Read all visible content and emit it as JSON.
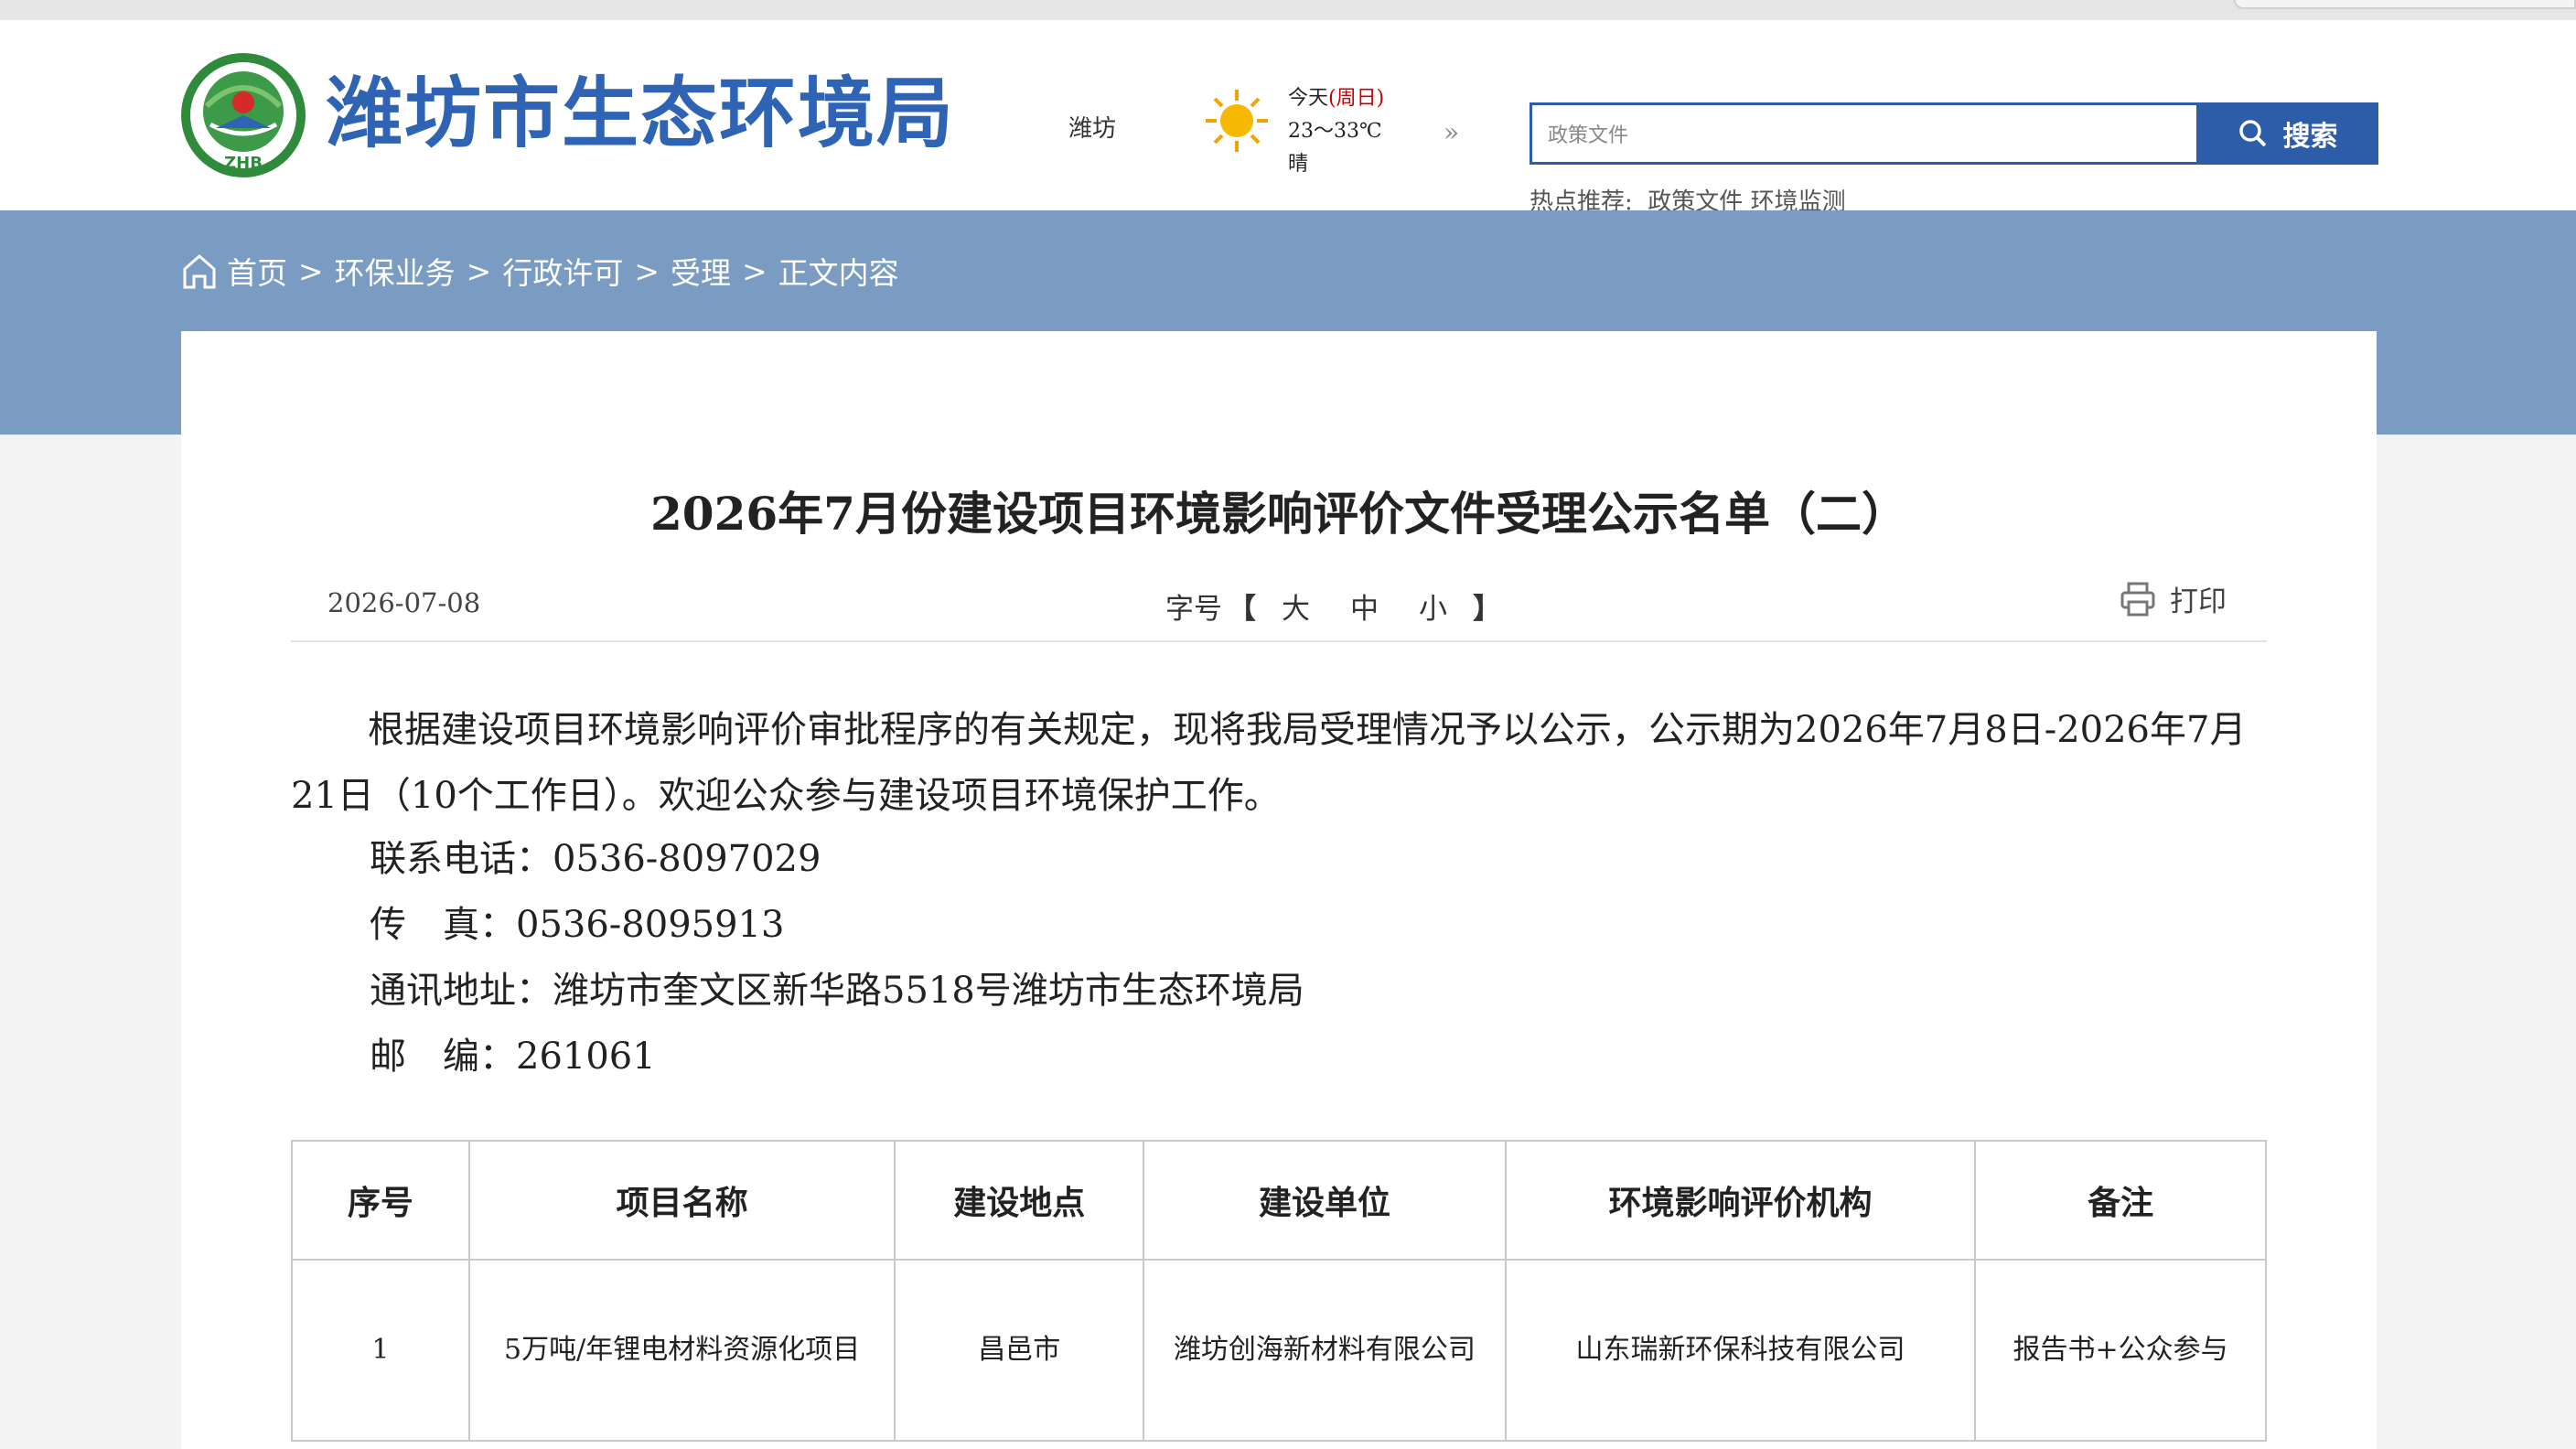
{
  "site": {
    "title": "潍坊市生态环境局",
    "logo_text": "ZHB"
  },
  "weather": {
    "city": "潍坊",
    "day": "今天",
    "weekday": "周日",
    "temp": "23～33℃",
    "condition": "晴",
    "icon": "sun-icon",
    "more_icon": "double-chevron-right-icon"
  },
  "search": {
    "placeholder": "政策文件",
    "button_label": "搜索",
    "hot_label": "热点推荐:",
    "hot_items": [
      "政策文件",
      "环境监测"
    ]
  },
  "breadcrumb": [
    "首页",
    "环保业务",
    "行政许可",
    "受理",
    "正文内容"
  ],
  "article": {
    "title": "2026年7月份建设项目环境影响评价文件受理公示名单（二）",
    "date": "2026-07-08",
    "font_size_label": "字号",
    "font_size_options": [
      "大",
      "中",
      "小"
    ],
    "print_label": "打印",
    "intro": "根据建设项目环境影响评价审批程序的有关规定，现将我局受理情况予以公示，公示期为2026年7月8日-2026年7月21日（10个工作日）。欢迎公众参与建设项目环境保护工作。",
    "phone": "联系电话：0536-8097029",
    "fax": "传　真：0536-8095913",
    "address": "通讯地址：潍坊市奎文区新华路5518号潍坊市生态环境局",
    "postcode": "邮　编：261061"
  },
  "table": {
    "headers": [
      "序号",
      "项目名称",
      "建设地点",
      "建设单位",
      "环境影响评价机构",
      "备注"
    ],
    "rows": [
      [
        "1",
        "5万吨/年锂电材料资源化项目",
        "昌邑市",
        "潍坊创海新材料有限公司",
        "山东瑞新环保科技有限公司",
        "报告书+公众参与"
      ]
    ]
  }
}
